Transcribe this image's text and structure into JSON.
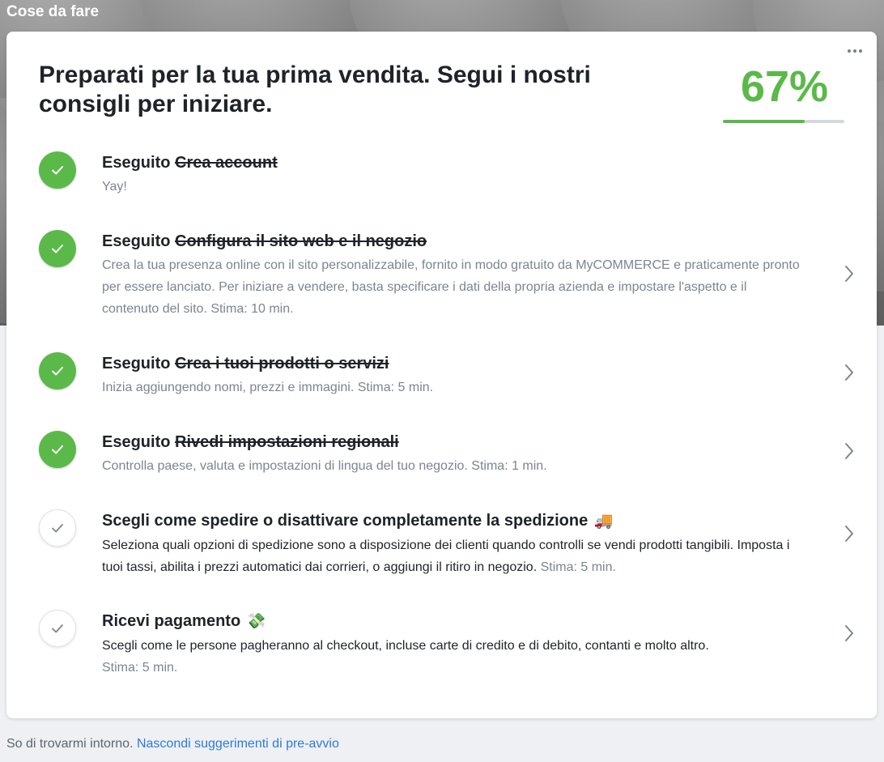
{
  "header": {
    "title": "Cose da fare"
  },
  "card": {
    "title": "Preparati per la tua prima vendita. Segui i nostri consigli per iniziare.",
    "progress": {
      "label": "67%",
      "value": 0.67,
      "color": "#5bb94a"
    },
    "more_icon": "more-horizontal-icon"
  },
  "tasks": [
    {
      "status": "done",
      "prefix": "Eseguito",
      "title": "Crea account",
      "description": "Yay!",
      "estimate": ""
    },
    {
      "status": "done",
      "prefix": "Eseguito",
      "title": "Configura il sito web e il negozio",
      "description": "Crea la tua presenza online con il sito personalizzabile, fornito in modo gratuito da MyCOMMERCE e praticamente pronto per essere lanciato. Per iniziare a vendere, basta specificare i dati della propria azienda e impostare l'aspetto e il contenuto del sito. Stima: 10 min.",
      "estimate": ""
    },
    {
      "status": "done",
      "prefix": "Eseguito",
      "title": "Crea i tuoi prodotti o servizi",
      "description": "Inizia aggiungendo nomi, prezzi e immagini. Stima: 5 min.",
      "estimate": ""
    },
    {
      "status": "done",
      "prefix": "Eseguito",
      "title": "Rivedi impostazioni regionali",
      "description": "Controlla paese, valuta e impostazioni di lingua del tuo negozio. Stima: 1 min.",
      "estimate": ""
    },
    {
      "status": "todo",
      "prefix": "",
      "title": "Scegli come spedire o disattivare completamente la spedizione",
      "emoji": "🚚",
      "description": "Seleziona quali opzioni di spedizione sono a disposizione dei clienti quando controlli se vendi prodotti tangibili. Imposta i tuoi tassi, abilita i prezzi automatici dai corrieri, o aggiungi il ritiro in negozio.",
      "estimate": "Stima: 5 min."
    },
    {
      "status": "todo",
      "prefix": "",
      "title": "Ricevi pagamento",
      "emoji": "💸",
      "description": "Scegli come le persone pagheranno al checkout, incluse carte di credito e di debito, contanti e molto altro.",
      "estimate": "Stima: 5 min."
    }
  ],
  "footer": {
    "text": "So di trovarmi intorno.",
    "link": "Nascondi suggerimenti di pre-avvio"
  }
}
